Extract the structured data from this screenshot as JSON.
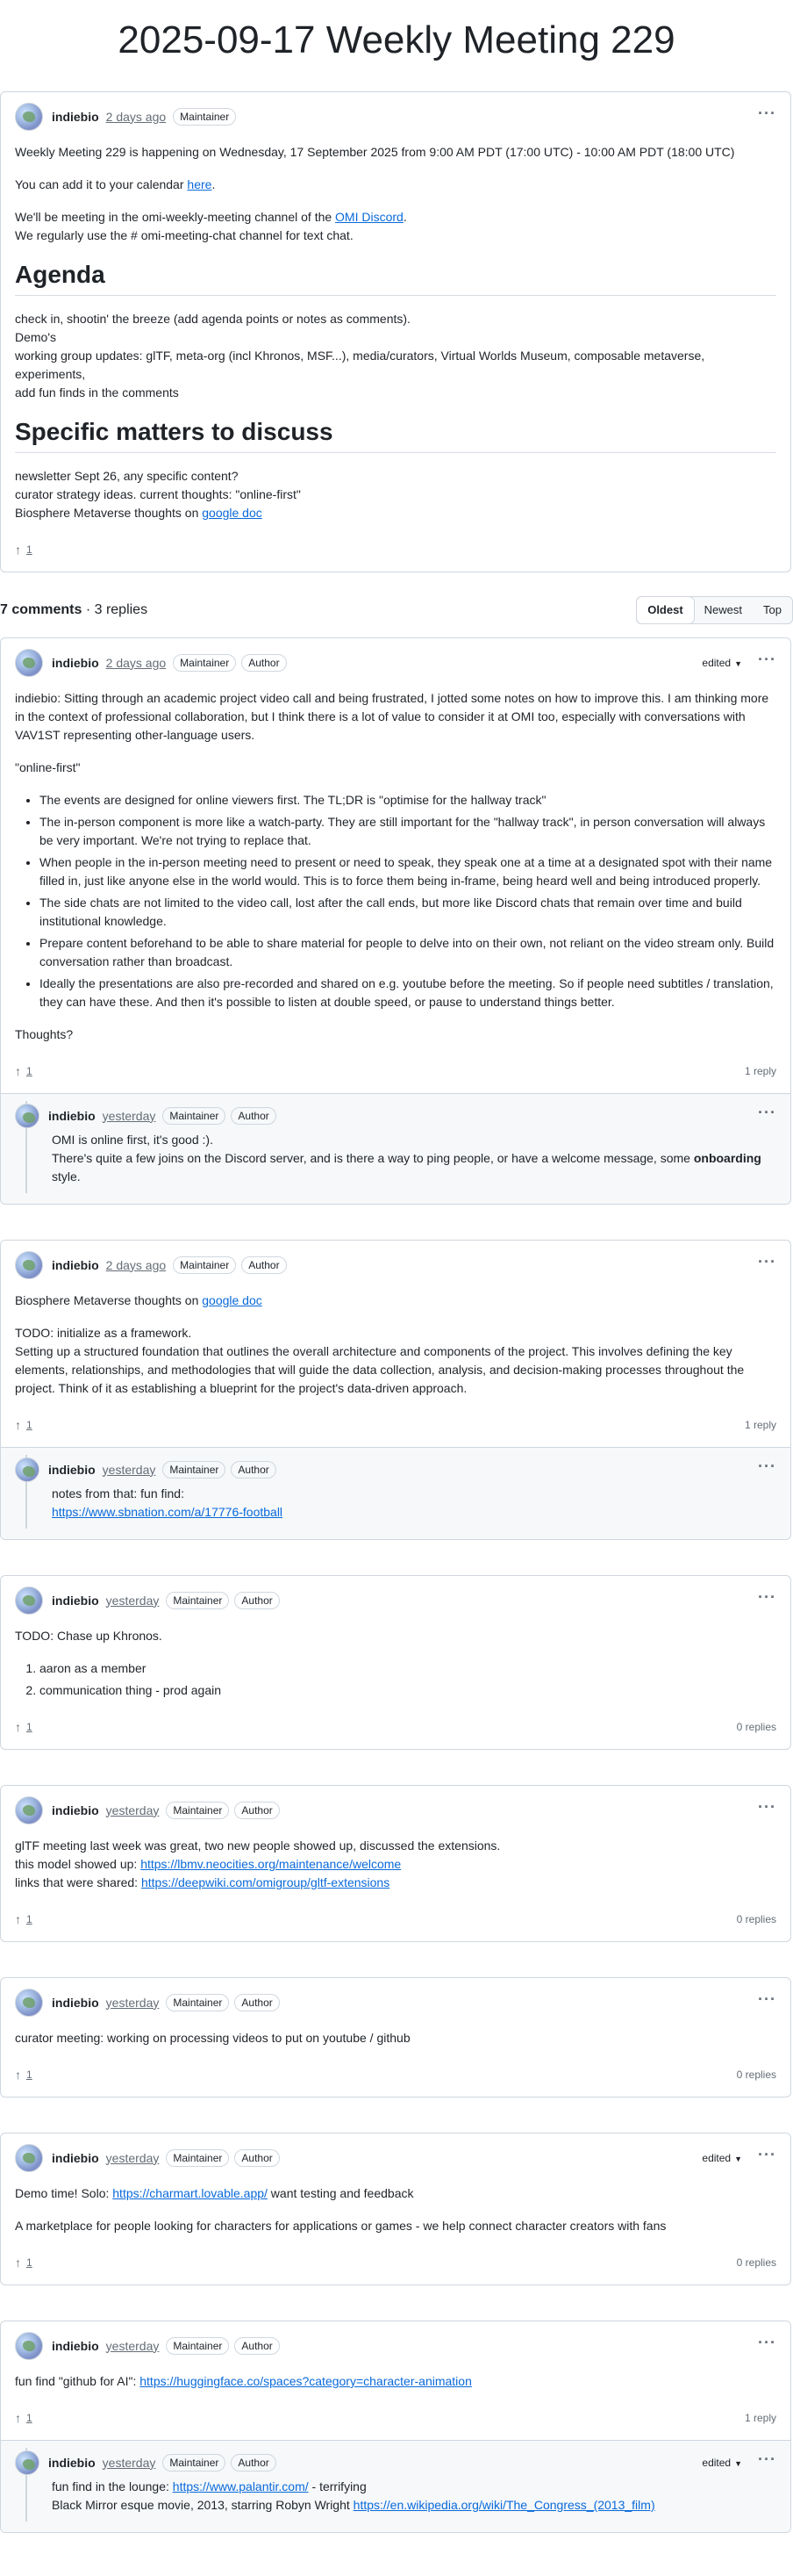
{
  "title": "2025-09-17 Weekly Meeting 229",
  "icons": {
    "more": "kebab-horizontal-icon",
    "upvote": "arrow-up-icon",
    "caret": "triangle-down-icon",
    "avatar": "globe-avatar"
  },
  "common": {
    "author": "indiebio",
    "maintainer": "Maintainer",
    "author_badge": "Author",
    "edited": "edited"
  },
  "op": {
    "time": "2 days ago",
    "p1": "Weekly Meeting 229 is happening on Wednesday, 17 September 2025 from 9:00 AM PDT (17:00 UTC) - 10:00 AM PDT (18:00 UTC)",
    "p2_pre": "You can add it to your calendar ",
    "p2_link": "here",
    "p2_post": ".",
    "p3_pre": "We'll be meeting in the omi-weekly-meeting channel of the ",
    "p3_link": "OMI Discord",
    "p3_post": ".",
    "p3_line2": "We regularly use the # omi-meeting-chat channel for text chat.",
    "agenda_heading": "Agenda",
    "agenda": [
      "check in, shootin' the breeze (add agenda points or notes as comments).",
      "Demo's",
      "working group updates: glTF, meta-org (incl Khronos, MSF...), media/curators, Virtual Worlds Museum, composable metaverse, experiments,",
      "add fun finds in the comments"
    ],
    "specific_heading": "Specific matters to discuss",
    "specific": [
      "newsletter Sept 26, any specific content?",
      "curator strategy ideas. current thoughts: \"online-first\""
    ],
    "specific_last_pre": "Biosphere Metaverse thoughts on ",
    "specific_last_link": "google doc",
    "votes": "1"
  },
  "comments_bar": {
    "count": "7 comments",
    "replies": " · 3 replies",
    "sort": [
      "Oldest",
      "Newest",
      "Top"
    ]
  },
  "c1": {
    "time": "2 days ago",
    "intro": "indiebio: Sitting through an academic project video call and being frustrated, I jotted some notes on how to improve this. I am thinking more in the context of professional collaboration, but I think there is a lot of value to consider it at OMI too, especially with conversations with VAV1ST representing other-language users.",
    "quote": "\"online-first\"",
    "bullets": [
      "The events are designed for online viewers first. The TL;DR is \"optimise for the hallway track\"",
      "The in-person component is more like a watch-party. They are still important for the \"hallway track\", in person conversation will always be very important. We're not trying to replace that.",
      "When people in the in-person meeting need to present or need to speak, they speak one at a time at a designated spot with their name filled in, just like anyone else in the world would. This is to force them being in-frame, being heard well and being introduced properly.",
      "The side chats are not limited to the video call, lost after the call ends, but more like Discord chats that remain over time and build institutional knowledge.",
      "Prepare content beforehand to be able to share material for people to delve into on their own, not reliant on the video stream only. Build conversation rather than broadcast.",
      "Ideally the presentations are also pre-recorded and shared on e.g. youtube before the meeting. So if people need subtitles / translation, they can have these. And then it's possible to listen at double speed, or pause to understand things better."
    ],
    "thoughts": "Thoughts?",
    "votes": "1",
    "replies": "1 reply",
    "reply": {
      "time": "yesterday",
      "line1": "OMI is online first, it's good :).",
      "line2_pre": "There's quite a few joins on the Discord server, and is there a way to ping people, or have a welcome message, some ",
      "line2_bold": "onboarding",
      "line2_post": " style."
    }
  },
  "c2": {
    "time": "2 days ago",
    "p1_pre": "Biosphere Metaverse thoughts on ",
    "p1_link": "google doc",
    "p2_line1": "TODO: initialize as a framework.",
    "p2_line2": "Setting up a structured foundation that outlines the overall architecture and components of the project. This involves defining the key elements, relationships, and methodologies that will guide the data collection, analysis, and decision-making processes throughout the project. Think of it as establishing a blueprint for the project's data-driven approach.",
    "votes": "1",
    "replies": "1 reply",
    "reply": {
      "time": "yesterday",
      "line1": "notes from that: fun find:",
      "link": "https://www.sbnation.com/a/17776-football"
    }
  },
  "c3": {
    "time": "yesterday",
    "p1": "TODO: Chase up Khronos.",
    "items": [
      "aaron as a member",
      "communication thing - prod again"
    ],
    "votes": "1",
    "replies": "0 replies"
  },
  "c4": {
    "time": "yesterday",
    "line1": "glTF meeting last week was great, two new people showed up, discussed the extensions.",
    "line2_pre": "this model showed up: ",
    "line2_link": "https://lbmv.neocities.org/maintenance/welcome",
    "line3_pre": "links that were shared: ",
    "line3_link": "https://deepwiki.com/omigroup/gltf-extensions",
    "votes": "1",
    "replies": "0 replies"
  },
  "c5": {
    "time": "yesterday",
    "p1": "curator meeting: working on processing videos to put on youtube / github",
    "votes": "1",
    "replies": "0 replies"
  },
  "c6": {
    "time": "yesterday",
    "p1_pre": "Demo time! Solo: ",
    "p1_link": "https://charmart.lovable.app/",
    "p1_post": " want testing and feedback",
    "p2": "A marketplace for people looking for characters for applications or games - we help connect character creators with fans",
    "votes": "1",
    "replies": "0 replies"
  },
  "c7": {
    "time": "yesterday",
    "p1_pre": "fun find \"github for AI\": ",
    "p1_link": "https://huggingface.co/spaces?category=character-animation",
    "votes": "1",
    "replies": "1 reply",
    "reply": {
      "time": "yesterday",
      "line1_pre": "fun find in the lounge: ",
      "line1_link": "https://www.palantir.com/",
      "line1_post": " - terrifying",
      "line2_pre": "Black Mirror esque movie, 2013, starring Robyn Wright ",
      "line2_link": "https://en.wikipedia.org/wiki/The_Congress_(2013_film)"
    }
  }
}
